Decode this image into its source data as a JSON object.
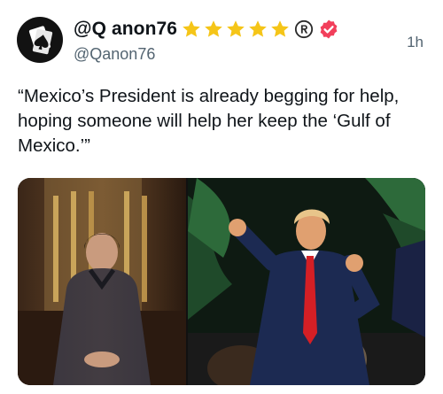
{
  "post": {
    "display_name": "@Q anon76",
    "handle": "@Qanon76",
    "timestamp": "1h",
    "text": "“Mexico’s President is already begging for help, hoping someone will help her keep the ‘Gulf of Mexico.’”",
    "badges": {
      "star_count": 5,
      "star_icon": "star-icon",
      "registered_icon": "registered-icon",
      "verified_icon": "verified-badge-icon"
    },
    "avatar_icon": "card-spade-logo-icon",
    "media": {
      "count": 2,
      "photos": [
        "photo-woman-speaking",
        "photo-man-gesturing"
      ]
    }
  },
  "colors": {
    "star": "#f5c518",
    "verified": "#f23f5b",
    "secondary_text": "#536471",
    "primary_text": "#0f1419"
  }
}
